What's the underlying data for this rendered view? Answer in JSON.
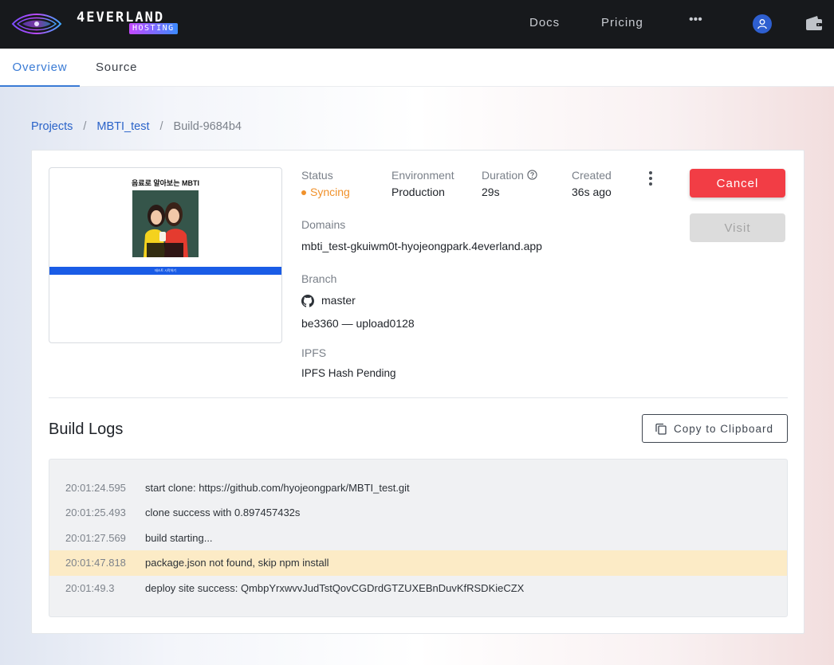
{
  "brand": {
    "name": "4EVERLAND",
    "sub": "HOSTING"
  },
  "topnav": {
    "docs": "Docs",
    "pricing": "Pricing",
    "more": "•••"
  },
  "tabs": [
    {
      "label": "Overview",
      "active": true
    },
    {
      "label": "Source",
      "active": false
    }
  ],
  "breadcrumb": {
    "projects": "Projects",
    "project": "MBTI_test",
    "current": "Build-9684b4",
    "separator": "/"
  },
  "preview": {
    "title": "음료로 알아보는 MBTI",
    "button_text": "테스트 시작하기"
  },
  "build": {
    "status_label": "Status",
    "status_value": "Syncing",
    "status_color": "#f0912b",
    "environment_label": "Environment",
    "environment_value": "Production",
    "duration_label": "Duration",
    "duration_value": "29s",
    "created_label": "Created",
    "created_value": "36s ago",
    "domains_label": "Domains",
    "domain_value": "mbti_test-gkuiwm0t-hyojeongpark.4everland.app",
    "branch_label": "Branch",
    "branch_value": "master",
    "commit_value": "be3360 — upload0128",
    "ipfs_label": "IPFS",
    "ipfs_value": "IPFS Hash Pending"
  },
  "actions": {
    "cancel": "Cancel",
    "visit": "Visit",
    "copy": "Copy to Clipboard"
  },
  "logs": {
    "title": "Build Logs",
    "rows": [
      {
        "time": "20:01:24.595",
        "message": "start clone: https://github.com/hyojeongpark/MBTI_test.git",
        "highlight": false
      },
      {
        "time": "20:01:25.493",
        "message": "clone success with 0.897457432s",
        "highlight": false
      },
      {
        "time": "20:01:27.569",
        "message": "build starting...",
        "highlight": false
      },
      {
        "time": "20:01:47.818",
        "message": "package.json not found, skip npm install",
        "highlight": true
      },
      {
        "time": "20:01:49.3",
        "message": "deploy site success: QmbpYrxwvvJudTstQovCGDrdGTZUXEBnDuvKfRSDKieCZX",
        "highlight": false
      }
    ]
  },
  "colors": {
    "accent": "#3a7bd5",
    "danger": "#f23d45",
    "topbar": "#17191c",
    "warn_row": "#fcebc6"
  }
}
